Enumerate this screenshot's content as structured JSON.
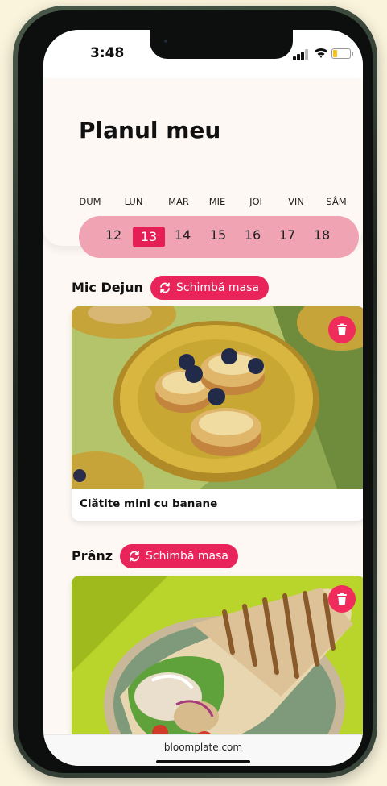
{
  "status_bar": {
    "time": "3:48"
  },
  "header": {
    "title": "Planul meu"
  },
  "week": {
    "day_names": [
      "DUM",
      "LUN",
      "MAR",
      "MIE",
      "JOI",
      "VIN",
      "SÂM"
    ],
    "dates": [
      "12",
      "13",
      "14",
      "15",
      "16",
      "17",
      "18"
    ],
    "selected_date": "13"
  },
  "meals": [
    {
      "section_title": "Mic Dejun",
      "swap_label": "Schimbă masa",
      "name": "Clătite mini cu banane",
      "icon": "trash-icon"
    },
    {
      "section_title": "Prânz",
      "swap_label": "Schimbă masa",
      "name": "",
      "icon": "trash-icon"
    }
  ],
  "footer": {
    "url": "bloomplate.com"
  },
  "colors": {
    "accent": "#e9245a",
    "pill": "#f0a3b3",
    "background": "#faf4dc"
  }
}
